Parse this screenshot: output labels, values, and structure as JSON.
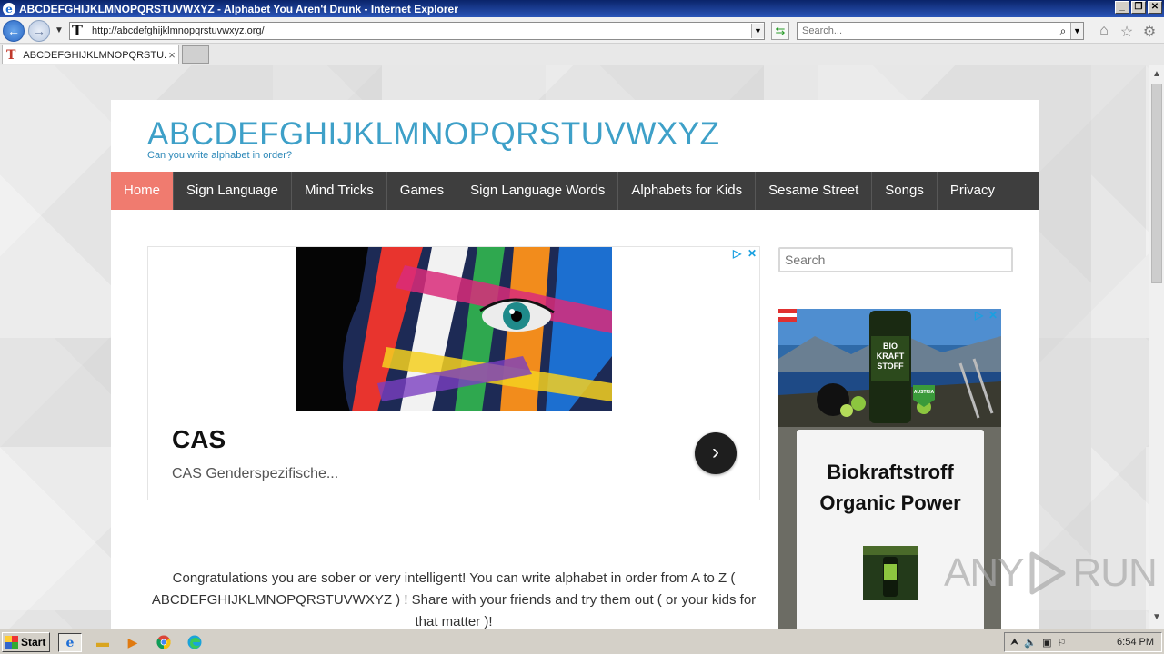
{
  "window": {
    "title": "ABCDEFGHIJKLMNOPQRSTUVWXYZ - Alphabet You Aren't Drunk - Internet Explorer",
    "controls": {
      "minimize": "_",
      "restore": "❐",
      "close": "✕"
    }
  },
  "browser": {
    "url": "http://abcdefghijklmnopqrstuvwxyz.org/",
    "search_placeholder": "Search...",
    "tab_title": "ABCDEFGHIJKLMNOPQRSTU...",
    "tab_close": "×",
    "favicon_letter": "T",
    "back_glyph": "←",
    "forward_glyph": "→",
    "dropdown_glyph": "▼",
    "refresh_glyph": "⇆",
    "search_glyph": "⌕",
    "home_glyph": "⌂",
    "favorites_glyph": "☆",
    "tools_glyph": "⚙"
  },
  "site": {
    "title": "ABCDEFGHIJKLMNOPQRSTUVWXYZ",
    "tagline": "Can you write alphabet in order?",
    "nav": [
      {
        "label": "Home",
        "active": true
      },
      {
        "label": "Sign Language"
      },
      {
        "label": "Mind Tricks"
      },
      {
        "label": "Games"
      },
      {
        "label": "Sign Language Words"
      },
      {
        "label": "Alphabets for Kids"
      },
      {
        "label": "Sesame Street"
      },
      {
        "label": "Songs"
      },
      {
        "label": "Privacy"
      }
    ],
    "ad1": {
      "headline": "CAS",
      "subtext": "CAS Genderspezifische...",
      "cta_glyph": "›",
      "choices_glyph": "▷",
      "close_glyph": "✕"
    },
    "body_text": "Congratulations you are sober or very intelligent! You can write alphabet in order from A to Z ( ABCDEFGHIJKLMNOPQRSTUVWXYZ ) ! Share with your friends and try them out ( or your kids for that matter )!",
    "sidebar_search_placeholder": "Search",
    "ad2": {
      "headline_line1": "Biokraftstroff",
      "headline_line2": "Organic Power",
      "can_text": "BIO KRAFT STOFF",
      "badge_text": "AUSTRIA"
    }
  },
  "watermark": {
    "left": "ANY",
    "right": "RUN"
  },
  "taskbar": {
    "start_label": "Start",
    "clock": "6:54 PM"
  },
  "colors": {
    "site_title": "#3ea0c8",
    "nav_bg": "#3e3e3e",
    "nav_active": "#f07b6f"
  }
}
